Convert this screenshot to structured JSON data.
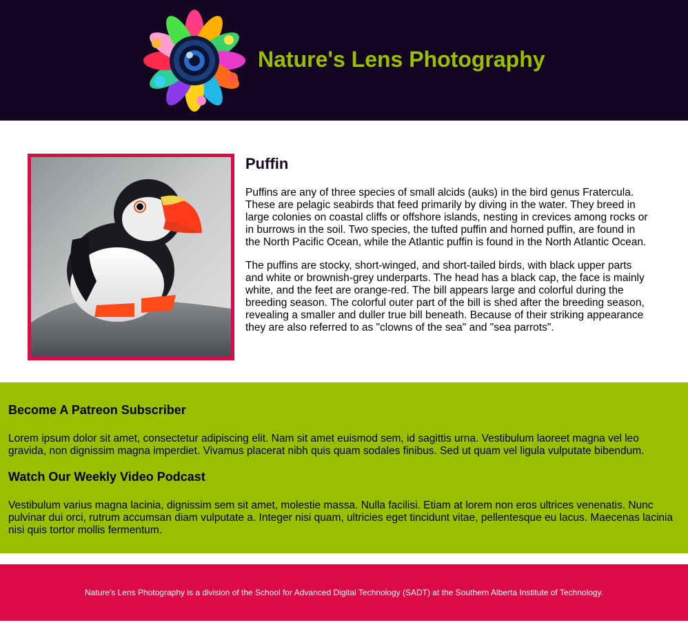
{
  "colors": {
    "header_bg": "#140522",
    "accent_green": "#99bf00",
    "accent_red": "#dc0a46"
  },
  "header": {
    "title": "Nature's Lens Photography",
    "logo_icon": "camera-lens-floral-logo-icon"
  },
  "article": {
    "title": "Puffin",
    "image_icon": "puffin-photo",
    "paragraphs": [
      "Puffins are any of three species of small alcids (auks) in the bird genus Fratercula. These are pelagic seabirds that feed primarily by diving in the water. They breed in large colonies on coastal cliffs or offshore islands, nesting in crevices among rocks or in burrows in the soil. Two species, the tufted puffin and horned puffin, are found in the North Pacific Ocean, while the Atlantic puffin is found in the North Atlantic Ocean.",
      "The puffins are stocky, short-winged, and short-tailed birds, with black upper parts and white or brownish-grey underparts. The head has a black cap, the face is mainly white, and the feet are orange-red. The bill appears large and colorful during the breeding season. The colorful outer part of the bill is shed after the breeding season, revealing a smaller and duller true bill beneath. Because of their striking appearance they are also referred to as \"clowns of the sea\" and \"sea parrots\"."
    ]
  },
  "promo": {
    "sections": [
      {
        "heading": "Become A Patreon Subscriber",
        "text": "Lorem ipsum dolor sit amet, consectetur adipiscing elit. Nam sit amet euismod sem, id sagittis urna. Vestibulum laoreet magna vel leo gravida, non dignissim magna imperdiet. Vivamus placerat nibh quis quam sodales finibus. Sed ut quam vel ligula vulputate bibendum."
      },
      {
        "heading": "Watch Our Weekly Video Podcast",
        "text": "Vestibulum varius magna lacinia, dignissim sem sit amet, molestie massa. Nulla facilisi. Etiam at lorem non eros ultrices venenatis. Nunc pulvinar dui orci, rutrum accumsan diam vulputate a. Integer nisi quam, ultricies eget tincidunt vitae, pellentesque eu lacus. Maecenas lacinia nisi quis tortor mollis fermentum."
      }
    ]
  },
  "footer": {
    "text": "Nature's Lens Photography is a division of the School for Advanced Digital Technology (SADT) at the Southern Alberta Institute of Technology."
  }
}
